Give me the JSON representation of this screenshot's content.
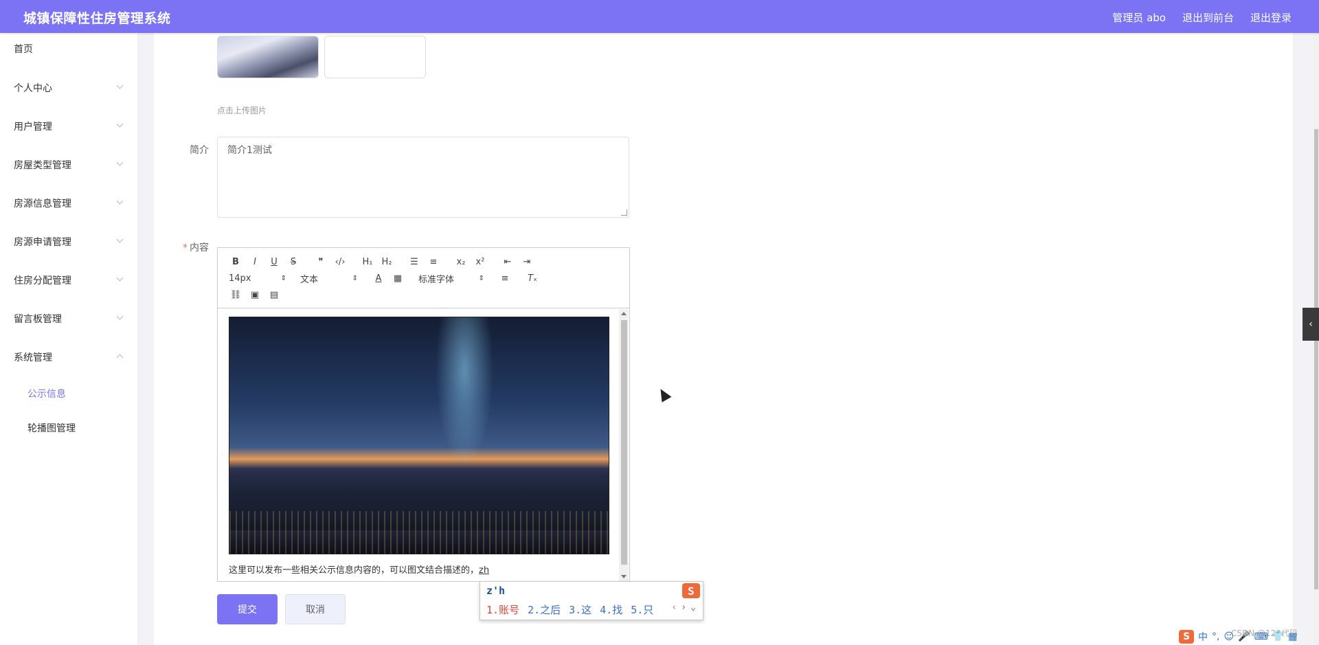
{
  "header": {
    "title": "城镇保障性住房管理系统",
    "user_label": "管理员 abo",
    "back_front": "退出到前台",
    "logout": "退出登录"
  },
  "sidebar": {
    "items": [
      {
        "label": "首页",
        "expandable": false
      },
      {
        "label": "个人中心",
        "expandable": true
      },
      {
        "label": "用户管理",
        "expandable": true
      },
      {
        "label": "房屋类型管理",
        "expandable": true
      },
      {
        "label": "房源信息管理",
        "expandable": true
      },
      {
        "label": "房源申请管理",
        "expandable": true
      },
      {
        "label": "住房分配管理",
        "expandable": true
      },
      {
        "label": "留言板管理",
        "expandable": true
      },
      {
        "label": "系统管理",
        "expandable": true,
        "expanded": true
      }
    ],
    "subitems": [
      {
        "label": "公示信息",
        "active": true
      },
      {
        "label": "轮播图管理",
        "active": false
      }
    ]
  },
  "form": {
    "upload_hint": "点击上传图片",
    "intro_label": "简介",
    "intro_value": "简介1测试",
    "content_label": "内容",
    "required_mark": "*",
    "editor": {
      "font_size": "14px",
      "text_type": "文本",
      "font_family": "标准字体",
      "body_text": "这里可以发布一些相关公示信息内容的，可以图文结合描述的，",
      "typed_text": "zh"
    },
    "submit_label": "提交",
    "cancel_label": "取消"
  },
  "ime": {
    "composition": "z'h",
    "candidates": [
      "1.账号",
      "2.之后",
      "3.这",
      "4.找",
      "5.只"
    ]
  },
  "tray": {
    "lang": "中",
    "watermark": "CSDN @123代码"
  },
  "colors": {
    "accent": "#7b73f3",
    "required": "#f56c6c"
  }
}
